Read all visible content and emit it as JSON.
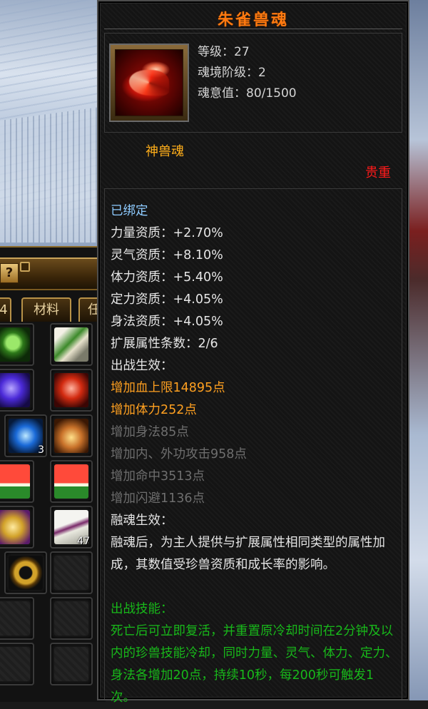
{
  "tooltip": {
    "title": "朱雀兽魂",
    "stats": [
      {
        "label": "等级",
        "value": "27"
      },
      {
        "label": "魂境阶级",
        "value": "2"
      },
      {
        "label": "魂意值",
        "value": "80/1500"
      }
    ],
    "kind": "神兽魂",
    "rarity": "贵重",
    "bound": "已绑定",
    "aptitudes": [
      {
        "label": "力量资质",
        "value": "+2.70%"
      },
      {
        "label": "灵气资质",
        "value": "+8.10%"
      },
      {
        "label": "体力资质",
        "value": "+5.40%"
      },
      {
        "label": "定力资质",
        "value": "+4.05%"
      },
      {
        "label": "身法资质",
        "value": "+4.05%"
      }
    ],
    "extra_attr_count": {
      "label": "扩展属性条数",
      "value": "2/6"
    },
    "battle_effect_header": "出战生效：",
    "battle_effects_active": [
      "增加血上限14895点",
      "增加体力252点"
    ],
    "battle_effects_inactive": [
      "增加身法85点",
      "增加内、外功攻击958点",
      "增加命中3513点",
      "增加闪避1136点"
    ],
    "fusion_header": "融魂生效：",
    "fusion_text": "融魂后，为主人提供与扩展属性相同类型的属性加成，其数值受珍兽资质和成长率的影响。",
    "skill_header": "出战技能：",
    "skill_text": "死亡后可立即复活，并重置原冷却时间在2分钟及以内的珍兽技能冷却，同时力量、灵气、体力、定力、身法各增加20点，持续10秒，每200秒可触发1次。"
  },
  "inventory": {
    "help_label": "?",
    "tab_partial_left": "4",
    "tab_materials": "材料",
    "tab_partial_right": "任",
    "slots": [
      {
        "item": "green-ring-icon",
        "qty": ""
      },
      {
        "item": "green-scroll-icon",
        "qty": ""
      },
      {
        "item": "blue-feather-icon",
        "qty": ""
      },
      {
        "item": "red-phoenix-icon",
        "qty": ""
      },
      {
        "item": "blue-rune-icon",
        "qty": "3"
      },
      {
        "item": "treasure-pile-icon",
        "qty": ""
      },
      {
        "item": "watermelon-icon",
        "qty": ""
      },
      {
        "item": "watermelon-icon",
        "qty": ""
      },
      {
        "item": "gold-tray-icon",
        "qty": ""
      },
      {
        "item": "porcelain-bottle-icon",
        "qty": "47"
      },
      {
        "item": "gold-ring-icon",
        "qty": ""
      },
      {
        "item": "empty-slot",
        "qty": ""
      }
    ]
  },
  "colors": {
    "title": "#ff7a10",
    "bound": "#8ecbff",
    "active_effect": "#ffa020",
    "inactive_effect": "#6e6e6e",
    "skill": "#18b81a",
    "rarity": "#ff1a1a"
  }
}
